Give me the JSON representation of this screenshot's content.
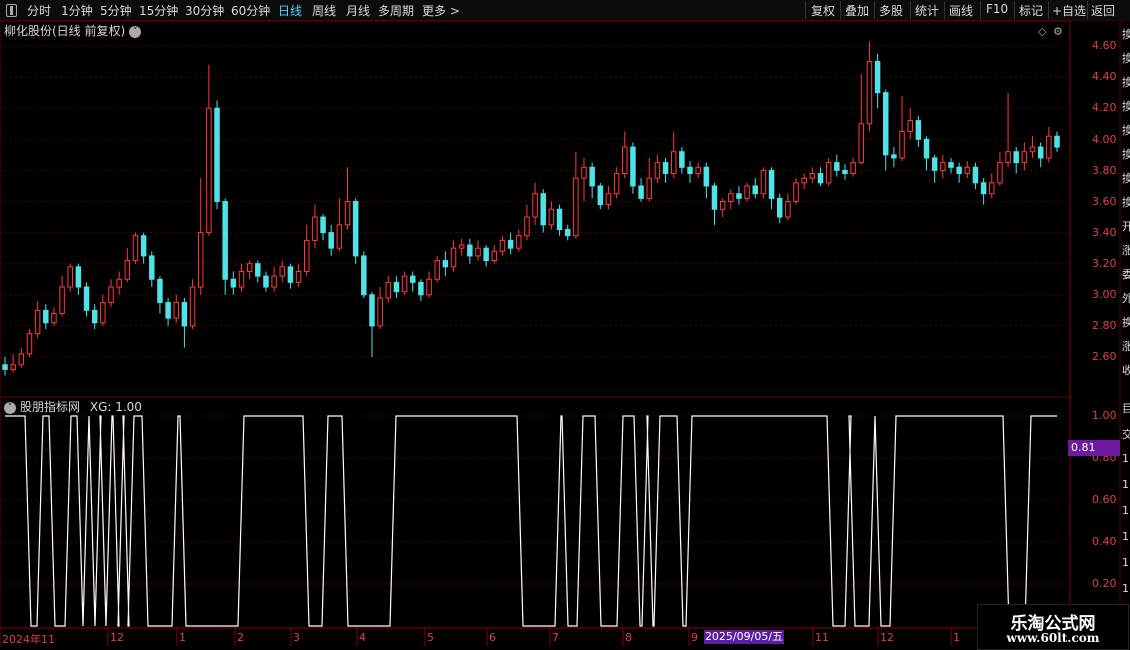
{
  "toolbar": {
    "left_items": [
      "分时",
      "1分钟",
      "5分钟",
      "15分钟",
      "30分钟",
      "60分钟",
      "日线",
      "周线",
      "月线",
      "多周期",
      "更多 >"
    ],
    "active_item": "日线",
    "right_items": [
      "复权",
      "叠加",
      "多股",
      "统计",
      "画线",
      "F10",
      "标记",
      "+自选",
      "返回"
    ]
  },
  "chart_header": {
    "stock_title": "柳化股份(日线 前复权)",
    "indicator_title": "股朋指标网",
    "indicator_value": "XG: 1.00",
    "current_value_badge": "0.81"
  },
  "price_axis_labels": [
    "4.60",
    "4.40",
    "4.20",
    "4.00",
    "3.80",
    "3.60",
    "3.40",
    "3.20",
    "3.00",
    "2.80",
    "2.60"
  ],
  "indicator_axis_labels": [
    "1.00",
    "0.80",
    "0.60",
    "0.40",
    "0.20"
  ],
  "x_axis": {
    "labels": [
      "2024年11",
      "12",
      "1",
      "2",
      "3",
      "4",
      "5",
      "6",
      "7",
      "8",
      "9",
      "11",
      "12",
      "1"
    ],
    "cursor_date": "2025/09/05/五"
  },
  "right_side_chars": [
    "換",
    "換",
    "換",
    "換",
    "換",
    "換",
    "換",
    "換",
    "开",
    "涨",
    "委",
    "外",
    "换",
    "涨",
    "收"
  ],
  "right_side_lower_chars": [
    "目",
    "交",
    "1",
    "1",
    "1",
    "1",
    "1",
    "1"
  ],
  "watermark": {
    "line1": "乐淘公式网",
    "line2": "www.60lt.com"
  },
  "colors": {
    "up": "#ff3a3a",
    "down": "#4fe3e8",
    "grid": "#5a0000",
    "axis_text": "#e04040",
    "signal": "#ffffff"
  },
  "chart_data": {
    "type": "candlestick",
    "price_range": [
      2.45,
      4.68
    ],
    "indicator_range": [
      0,
      1.0
    ],
    "candles_approx": [
      [
        2.55,
        2.52,
        2.6,
        2.48
      ],
      [
        2.52,
        2.55,
        2.62,
        2.5
      ],
      [
        2.55,
        2.62,
        2.66,
        2.53
      ],
      [
        2.62,
        2.75,
        2.78,
        2.6
      ],
      [
        2.75,
        2.9,
        2.96,
        2.72
      ],
      [
        2.9,
        2.82,
        2.94,
        2.78
      ],
      [
        2.82,
        2.88,
        2.92,
        2.8
      ],
      [
        2.88,
        3.05,
        3.12,
        2.86
      ],
      [
        3.05,
        3.18,
        3.2,
        3.02
      ],
      [
        3.18,
        3.05,
        3.2,
        3.0
      ],
      [
        3.05,
        2.9,
        3.08,
        2.86
      ],
      [
        2.9,
        2.82,
        2.94,
        2.78
      ],
      [
        2.82,
        2.95,
        3.0,
        2.8
      ],
      [
        2.95,
        3.05,
        3.1,
        2.92
      ],
      [
        3.05,
        3.1,
        3.15,
        3.0
      ],
      [
        3.1,
        3.22,
        3.3,
        3.08
      ],
      [
        3.22,
        3.38,
        3.4,
        3.2
      ],
      [
        3.38,
        3.25,
        3.4,
        3.2
      ],
      [
        3.25,
        3.1,
        3.28,
        3.05
      ],
      [
        3.1,
        2.95,
        3.12,
        2.88
      ],
      [
        2.95,
        2.85,
        2.98,
        2.8
      ],
      [
        2.85,
        2.95,
        3.0,
        2.82
      ],
      [
        2.95,
        2.8,
        2.98,
        2.66
      ],
      [
        2.8,
        3.05,
        3.1,
        2.78
      ],
      [
        3.05,
        3.4,
        3.75,
        3.0
      ],
      [
        3.4,
        4.2,
        4.48,
        3.38
      ],
      [
        4.2,
        3.6,
        4.25,
        3.55
      ],
      [
        3.6,
        3.1,
        3.62,
        3.0
      ],
      [
        3.1,
        3.05,
        3.15,
        3.0
      ],
      [
        3.05,
        3.15,
        3.2,
        3.02
      ],
      [
        3.15,
        3.2,
        3.22,
        3.1
      ],
      [
        3.2,
        3.12,
        3.22,
        3.08
      ],
      [
        3.12,
        3.05,
        3.15,
        3.02
      ],
      [
        3.05,
        3.12,
        3.18,
        3.02
      ],
      [
        3.12,
        3.18,
        3.22,
        3.08
      ],
      [
        3.18,
        3.08,
        3.2,
        3.04
      ],
      [
        3.08,
        3.15,
        3.2,
        3.05
      ],
      [
        3.15,
        3.35,
        3.45,
        3.12
      ],
      [
        3.35,
        3.5,
        3.58,
        3.3
      ],
      [
        3.5,
        3.4,
        3.52,
        3.35
      ],
      [
        3.4,
        3.3,
        3.45,
        3.25
      ],
      [
        3.3,
        3.45,
        3.62,
        3.28
      ],
      [
        3.45,
        3.6,
        3.82,
        3.42
      ],
      [
        3.6,
        3.25,
        3.62,
        3.2
      ],
      [
        3.25,
        3.0,
        3.28,
        2.98
      ],
      [
        3.0,
        2.8,
        3.02,
        2.6
      ],
      [
        2.8,
        2.98,
        3.05,
        2.78
      ],
      [
        2.98,
        3.08,
        3.12,
        2.95
      ],
      [
        3.08,
        3.02,
        3.12,
        2.98
      ],
      [
        3.02,
        3.12,
        3.15,
        3.0
      ],
      [
        3.12,
        3.08,
        3.15,
        3.02
      ],
      [
        3.08,
        3.0,
        3.1,
        2.96
      ],
      [
        3.0,
        3.1,
        3.15,
        2.98
      ],
      [
        3.1,
        3.22,
        3.25,
        3.08
      ],
      [
        3.22,
        3.18,
        3.28,
        3.12
      ],
      [
        3.18,
        3.3,
        3.35,
        3.15
      ],
      [
        3.3,
        3.32,
        3.36,
        3.25
      ],
      [
        3.32,
        3.25,
        3.36,
        3.2
      ],
      [
        3.25,
        3.3,
        3.35,
        3.22
      ],
      [
        3.3,
        3.22,
        3.32,
        3.18
      ],
      [
        3.22,
        3.28,
        3.32,
        3.2
      ],
      [
        3.28,
        3.35,
        3.38,
        3.25
      ],
      [
        3.35,
        3.3,
        3.4,
        3.26
      ],
      [
        3.3,
        3.38,
        3.42,
        3.28
      ],
      [
        3.38,
        3.5,
        3.58,
        3.35
      ],
      [
        3.5,
        3.65,
        3.72,
        3.45
      ],
      [
        3.65,
        3.45,
        3.68,
        3.4
      ],
      [
        3.45,
        3.55,
        3.6,
        3.42
      ],
      [
        3.55,
        3.42,
        3.58,
        3.38
      ],
      [
        3.42,
        3.38,
        3.45,
        3.35
      ],
      [
        3.38,
        3.75,
        3.92,
        3.36
      ],
      [
        3.75,
        3.82,
        3.88,
        3.6
      ],
      [
        3.82,
        3.7,
        3.85,
        3.62
      ],
      [
        3.7,
        3.58,
        3.72,
        3.55
      ],
      [
        3.58,
        3.65,
        3.7,
        3.55
      ],
      [
        3.65,
        3.78,
        3.82,
        3.62
      ],
      [
        3.78,
        3.95,
        4.05,
        3.75
      ],
      [
        3.95,
        3.7,
        3.98,
        3.65
      ],
      [
        3.7,
        3.62,
        3.75,
        3.6
      ],
      [
        3.62,
        3.75,
        3.88,
        3.6
      ],
      [
        3.75,
        3.85,
        3.9,
        3.72
      ],
      [
        3.85,
        3.78,
        3.88,
        3.72
      ],
      [
        3.78,
        3.92,
        4.05,
        3.75
      ],
      [
        3.92,
        3.82,
        3.95,
        3.78
      ],
      [
        3.82,
        3.78,
        3.86,
        3.72
      ],
      [
        3.78,
        3.82,
        3.85,
        3.75
      ],
      [
        3.82,
        3.7,
        3.85,
        3.62
      ],
      [
        3.7,
        3.55,
        3.72,
        3.45
      ],
      [
        3.55,
        3.6,
        3.62,
        3.5
      ],
      [
        3.6,
        3.65,
        3.68,
        3.55
      ],
      [
        3.65,
        3.62,
        3.7,
        3.58
      ],
      [
        3.62,
        3.7,
        3.72,
        3.6
      ],
      [
        3.7,
        3.65,
        3.75,
        3.62
      ],
      [
        3.65,
        3.8,
        3.82,
        3.62
      ],
      [
        3.8,
        3.62,
        3.82,
        3.55
      ],
      [
        3.62,
        3.5,
        3.65,
        3.46
      ],
      [
        3.5,
        3.6,
        3.65,
        3.48
      ],
      [
        3.6,
        3.72,
        3.75,
        3.58
      ],
      [
        3.72,
        3.75,
        3.78,
        3.68
      ],
      [
        3.75,
        3.78,
        3.82,
        3.72
      ],
      [
        3.78,
        3.72,
        3.82,
        3.7
      ],
      [
        3.72,
        3.85,
        3.88,
        3.7
      ],
      [
        3.85,
        3.8,
        3.9,
        3.76
      ],
      [
        3.8,
        3.78,
        3.84,
        3.74
      ],
      [
        3.78,
        3.85,
        3.88,
        3.76
      ],
      [
        3.85,
        4.1,
        4.42,
        3.84
      ],
      [
        4.1,
        4.5,
        4.63,
        4.05
      ],
      [
        4.5,
        4.3,
        4.55,
        4.2
      ],
      [
        4.3,
        3.9,
        4.32,
        3.8
      ],
      [
        3.9,
        3.88,
        3.95,
        3.82
      ],
      [
        3.88,
        4.05,
        4.28,
        3.86
      ],
      [
        4.05,
        4.12,
        4.2,
        4.0
      ],
      [
        4.12,
        4.0,
        4.15,
        3.95
      ],
      [
        4.0,
        3.88,
        4.02,
        3.8
      ],
      [
        3.88,
        3.8,
        3.9,
        3.72
      ],
      [
        3.8,
        3.85,
        3.9,
        3.75
      ],
      [
        3.85,
        3.82,
        3.88,
        3.78
      ],
      [
        3.82,
        3.78,
        3.85,
        3.72
      ],
      [
        3.78,
        3.82,
        3.86,
        3.75
      ],
      [
        3.82,
        3.72,
        3.85,
        3.68
      ],
      [
        3.72,
        3.65,
        3.75,
        3.58
      ],
      [
        3.65,
        3.72,
        3.78,
        3.62
      ],
      [
        3.72,
        3.85,
        3.92,
        3.7
      ],
      [
        3.85,
        3.92,
        4.3,
        3.82
      ],
      [
        3.92,
        3.85,
        3.95,
        3.78
      ],
      [
        3.85,
        3.92,
        3.98,
        3.8
      ],
      [
        3.92,
        3.95,
        4.02,
        3.88
      ],
      [
        3.95,
        3.88,
        3.98,
        3.82
      ],
      [
        3.88,
        4.02,
        4.08,
        3.85
      ],
      [
        4.02,
        3.95,
        4.05,
        3.92
      ]
    ],
    "xg_signal": "binary 0/1 stepped line, alternating periods"
  }
}
